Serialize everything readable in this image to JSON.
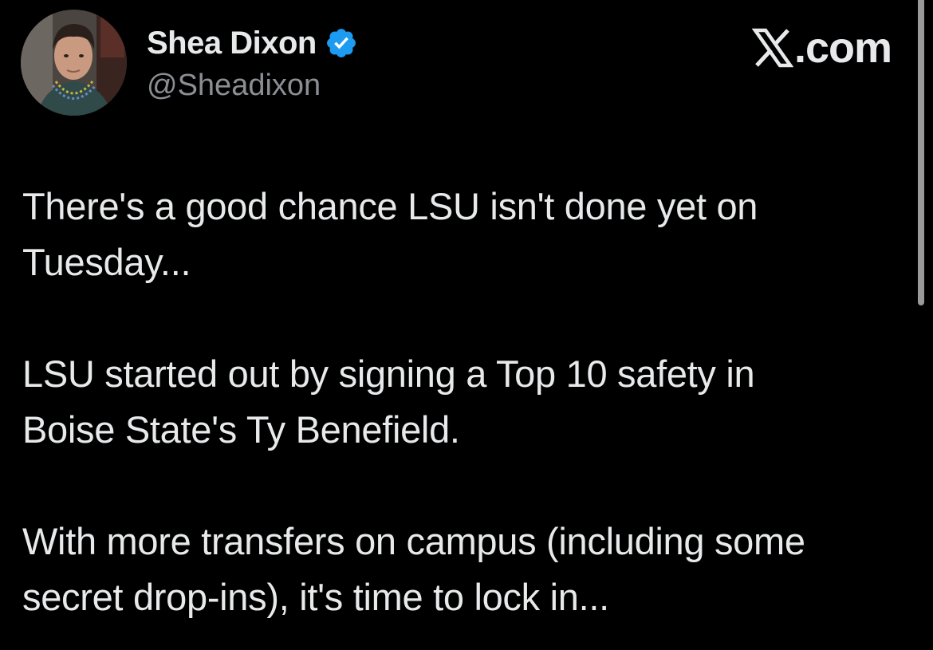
{
  "author": {
    "display_name": "Shea Dixon",
    "handle": "@Sheadixon",
    "verified": true,
    "avatar_icon": "profile-photo-avatar"
  },
  "brand": {
    "logo_icon": "x-logo-icon",
    "text": ".com"
  },
  "tweet": {
    "paragraphs": [
      "There's a good chance LSU isn't done yet on\nTuesday...",
      "LSU started out by signing a Top 10 safety in\nBoise State's Ty Benefield.",
      "With more transfers on campus (including some\nsecret drop-ins), it's time to lock in..."
    ]
  },
  "colors": {
    "background": "#000000",
    "text_primary": "#e7e9ea",
    "text_secondary": "#8b8f94",
    "verified_blue": "#1d9bf0"
  }
}
